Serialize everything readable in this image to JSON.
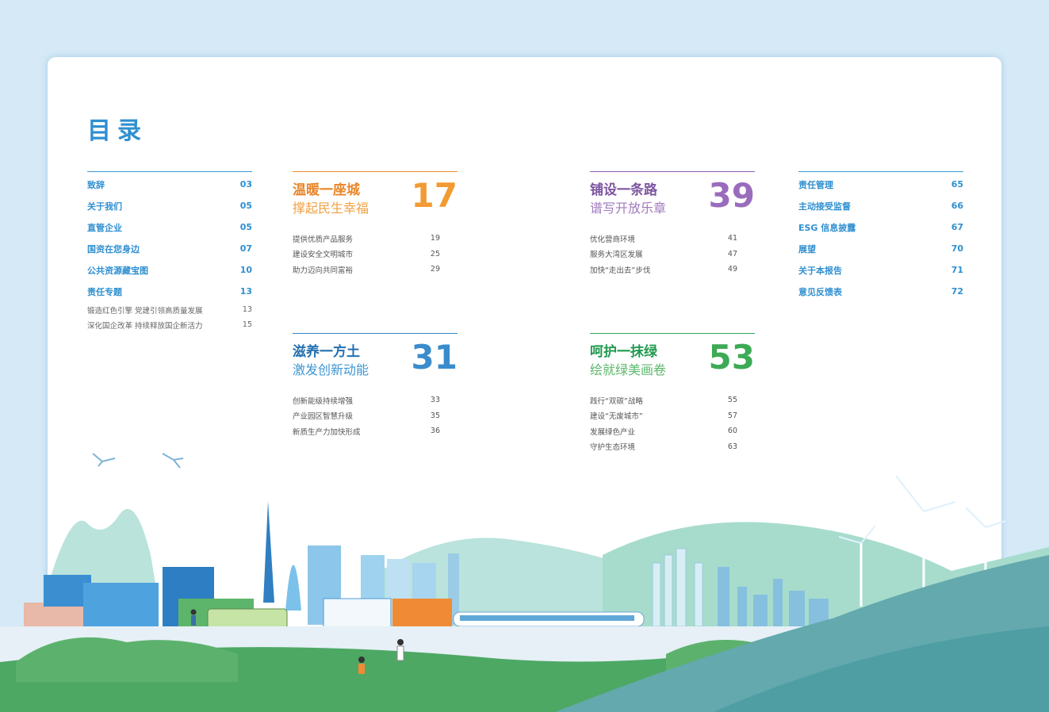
{
  "title": "目录",
  "left_toc": [
    {
      "label": "致辞",
      "page": "03"
    },
    {
      "label": "关于我们",
      "page": "05"
    },
    {
      "label": "直管企业",
      "page": "05"
    },
    {
      "label": "国资在您身边",
      "page": "07"
    },
    {
      "label": "公共资源藏宝图",
      "page": "10"
    },
    {
      "label": "责任专题",
      "page": "13"
    }
  ],
  "left_sub": [
    {
      "label": "锻造红色引擎  党建引领高质量发展",
      "page": "13"
    },
    {
      "label": "深化国企改革  持续释放国企新活力",
      "page": "15"
    }
  ],
  "chapters": [
    {
      "title1": "温暖一座城",
      "title2": "撑起民生幸福",
      "number": "17",
      "items": [
        {
          "label": "提供优质产品服务",
          "page": "19"
        },
        {
          "label": "建设安全文明城市",
          "page": "25"
        },
        {
          "label": "助力迈向共同富裕",
          "page": "29"
        }
      ]
    },
    {
      "title1": "铺设一条路",
      "title2": "谱写开放乐章",
      "number": "39",
      "items": [
        {
          "label": "优化营商环境",
          "page": "41"
        },
        {
          "label": "服务大湾区发展",
          "page": "47"
        },
        {
          "label": "加快“走出去”步伐",
          "page": "49"
        }
      ]
    },
    {
      "title1": "滋养一方土",
      "title2": "激发创新动能",
      "number": "31",
      "items": [
        {
          "label": "创新能级持续增强",
          "page": "33"
        },
        {
          "label": "产业园区智慧升级",
          "page": "35"
        },
        {
          "label": "新质生产力加快形成",
          "page": "36"
        }
      ]
    },
    {
      "title1": "呵护一抹绿",
      "title2": "绘就绿美画卷",
      "number": "53",
      "items": [
        {
          "label": "践行“双碳”战略",
          "page": "55"
        },
        {
          "label": "建设“无废城市”",
          "page": "57"
        },
        {
          "label": "发展绿色产业",
          "page": "60"
        },
        {
          "label": "守护生态环境",
          "page": "63"
        }
      ]
    }
  ],
  "right_toc": [
    {
      "label": "责任管理",
      "page": "65"
    },
    {
      "label": "主动接受监督",
      "page": "66"
    },
    {
      "label": "ESG 信息披露",
      "page": "67"
    },
    {
      "label": "展望",
      "page": "70"
    },
    {
      "label": "关于本报告",
      "page": "71"
    },
    {
      "label": "意见反馈表",
      "page": "72"
    }
  ],
  "colors": {
    "blue": "#2f8fd0",
    "orange": "#ee8a2d",
    "purple": "#8a5fa8",
    "teal_blue": "#2e87c5",
    "green": "#32a55e"
  }
}
